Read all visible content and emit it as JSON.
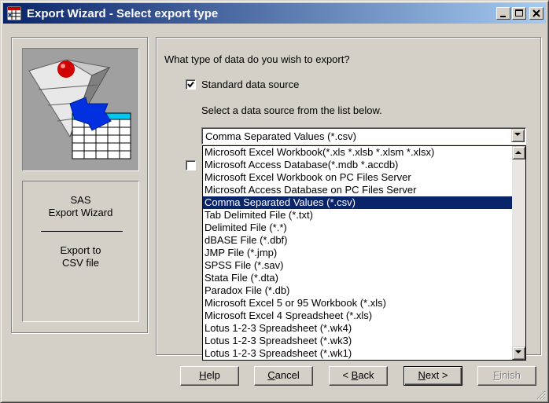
{
  "window": {
    "title": "Export Wizard - Select export type",
    "app_icon": "sas-grid-icon",
    "controls": [
      "minimize-icon",
      "maximize-icon",
      "close-icon"
    ],
    "title_gradient": [
      "#0a246a",
      "#a6caf0"
    ]
  },
  "sidebar": {
    "image": "export-wizard-graphic",
    "title_line1": "SAS",
    "title_line2": "Export Wizard",
    "desc_line1": "Export to",
    "desc_line2": "CSV file"
  },
  "main": {
    "question": "What type of data do you wish to export?",
    "standard_source": {
      "label": "Standard data source",
      "checked": true
    },
    "select_prompt": "Select a data source from the list below.",
    "combo_value": "Comma Separated Values (*.csv)",
    "other_checkbox_checked": false,
    "dropdown_items": [
      "Microsoft Excel Workbook(*.xls *.xlsb *.xlsm *.xlsx)",
      "Microsoft Access Database(*.mdb *.accdb)",
      "Microsoft Excel Workbook on PC Files Server",
      "Microsoft Access Database on PC Files Server",
      "Comma Separated Values (*.csv)",
      "Tab Delimited File (*.txt)",
      "Delimited File (*.*)",
      "dBASE File (*.dbf)",
      "JMP File (*.jmp)",
      "SPSS File (*.sav)",
      "Stata File (*.dta)",
      "Paradox File (*.db)",
      "Microsoft Excel 5 or 95 Workbook (*.xls)",
      "Microsoft Excel 4 Spreadsheet (*.xls)",
      "Lotus 1-2-3 Spreadsheet (*.wk4)",
      "Lotus 1-2-3 Spreadsheet (*.wk3)",
      "Lotus 1-2-3 Spreadsheet (*.wk1)"
    ],
    "selected_item": "Comma Separated Values (*.csv)",
    "selection_color": "#0a246a"
  },
  "buttons": {
    "help": "Help",
    "help_key": "H",
    "cancel": "Cancel",
    "cancel_key": "C",
    "back": "< Back",
    "back_key": "B",
    "next": "Next >",
    "next_key": "N",
    "finish": "Finish",
    "finish_key": "F",
    "finish_enabled": false
  }
}
